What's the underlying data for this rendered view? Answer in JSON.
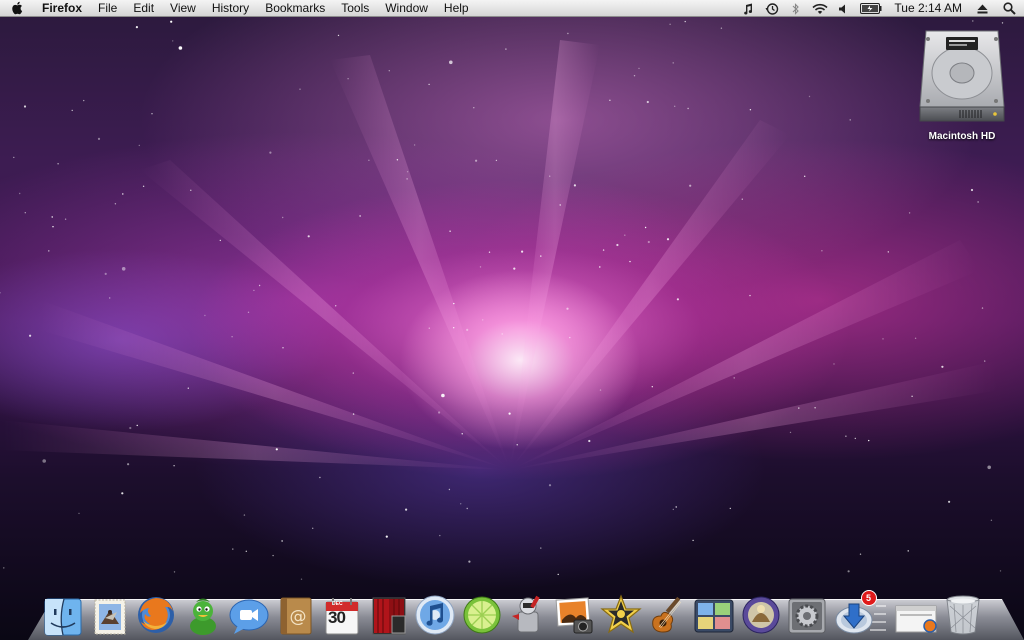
{
  "menubar": {
    "app_name": "Firefox",
    "menus": [
      "File",
      "Edit",
      "View",
      "History",
      "Bookmarks",
      "Tools",
      "Window",
      "Help"
    ],
    "clock": "Tue 2:14 AM",
    "status_icons": [
      "itunes-note-icon",
      "time-machine-icon",
      "bluetooth-icon",
      "wifi-icon",
      "volume-icon",
      "battery-icon",
      "eject-icon",
      "spotlight-icon"
    ]
  },
  "desktop": {
    "icons": [
      {
        "label": "Macintosh HD",
        "icon": "hard-drive-icon"
      }
    ]
  },
  "dock": {
    "apps": [
      {
        "name": "Finder",
        "icon": "finder-icon"
      },
      {
        "name": "Mail",
        "icon": "mail-stamp-icon"
      },
      {
        "name": "Firefox",
        "icon": "firefox-icon"
      },
      {
        "name": "Adium",
        "icon": "adium-duck-icon"
      },
      {
        "name": "iChat",
        "icon": "ichat-icon"
      },
      {
        "name": "Address Book",
        "icon": "address-book-icon"
      },
      {
        "name": "iCal",
        "icon": "ical-icon",
        "month": "DEC",
        "day": "30"
      },
      {
        "name": "Front Row",
        "icon": "front-row-icon"
      },
      {
        "name": "iTunes",
        "icon": "itunes-icon"
      },
      {
        "name": "LimeWire",
        "icon": "limewire-icon"
      },
      {
        "name": "Automator",
        "icon": "automator-icon"
      },
      {
        "name": "iPhoto",
        "icon": "iphoto-icon"
      },
      {
        "name": "iMovie",
        "icon": "imovie-icon"
      },
      {
        "name": "GarageBand",
        "icon": "garageband-icon"
      },
      {
        "name": "Spaces",
        "icon": "spaces-icon"
      },
      {
        "name": "Dictionary",
        "icon": "dictionary-icon"
      },
      {
        "name": "System Preferences",
        "icon": "system-preferences-icon"
      },
      {
        "name": "Software Update",
        "icon": "software-update-icon",
        "badge": "5"
      }
    ],
    "others": [
      {
        "name": "Firefox window",
        "icon": "minimized-window-icon"
      },
      {
        "name": "Trash",
        "icon": "trash-icon"
      }
    ]
  }
}
